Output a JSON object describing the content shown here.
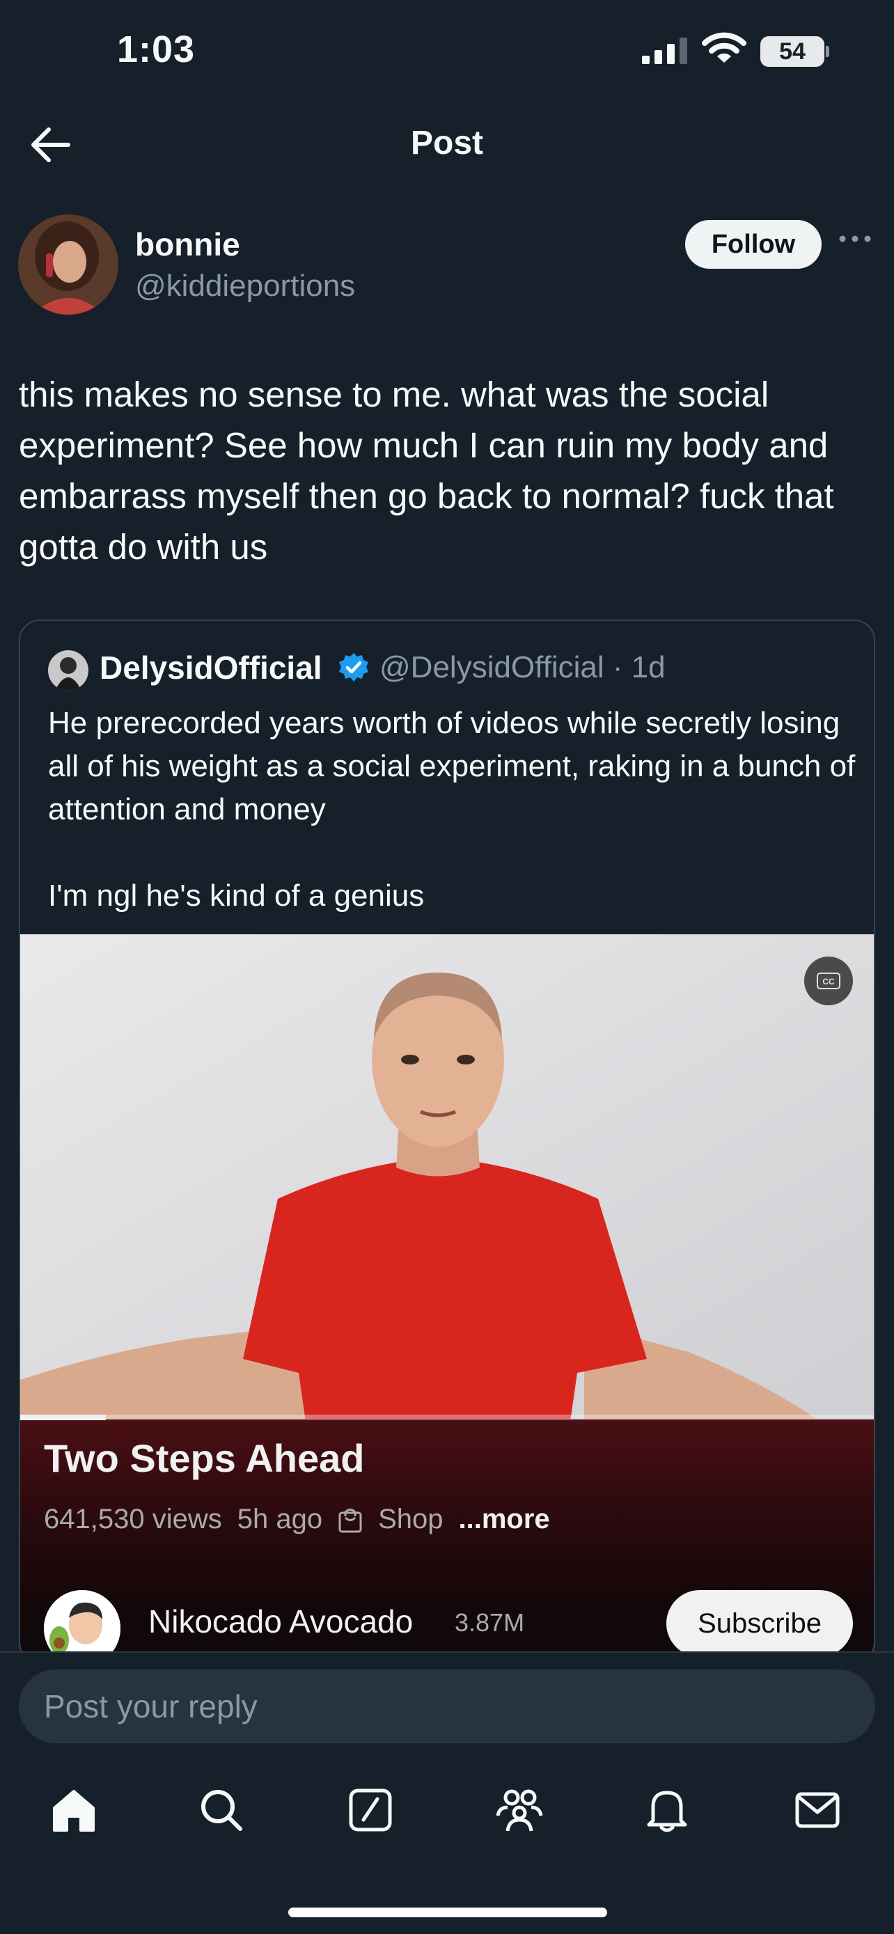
{
  "status_bar": {
    "time": "1:03",
    "battery": "54"
  },
  "header": {
    "title": "Post"
  },
  "author": {
    "name": "bonnie",
    "handle": "@kiddieportions",
    "follow_label": "Follow"
  },
  "post": {
    "text": "this makes no sense to me. what was the social experiment? See how much I can ruin my body and embarrass myself then go back to normal? fuck that gotta do with us"
  },
  "quote": {
    "name": "DelysidOfficial",
    "handle_time": "@DelysidOfficial · 1d",
    "text": "He prerecorded years worth of videos while secretly losing all of his weight as a social experiment, raking in a bunch of attention and money\n\nI'm ngl he's kind of a genius",
    "video": {
      "cc": "CC",
      "title": "Two Steps Ahead",
      "views": "641,530 views",
      "age": "5h ago",
      "shop": "Shop",
      "more": "...more",
      "channel": "Nikocado Avocado",
      "subscribers": "3.87M",
      "subscribe_label": "Subscribe",
      "progress": 0.1
    }
  },
  "reply": {
    "placeholder": "Post your reply"
  },
  "nav": [
    "home-icon",
    "search-icon",
    "compose-icon",
    "communities-icon",
    "notifications-icon",
    "messages-icon"
  ],
  "colors": {
    "background": "#15202b",
    "accent": "#1d9bf0",
    "muted": "#8b98a5"
  }
}
